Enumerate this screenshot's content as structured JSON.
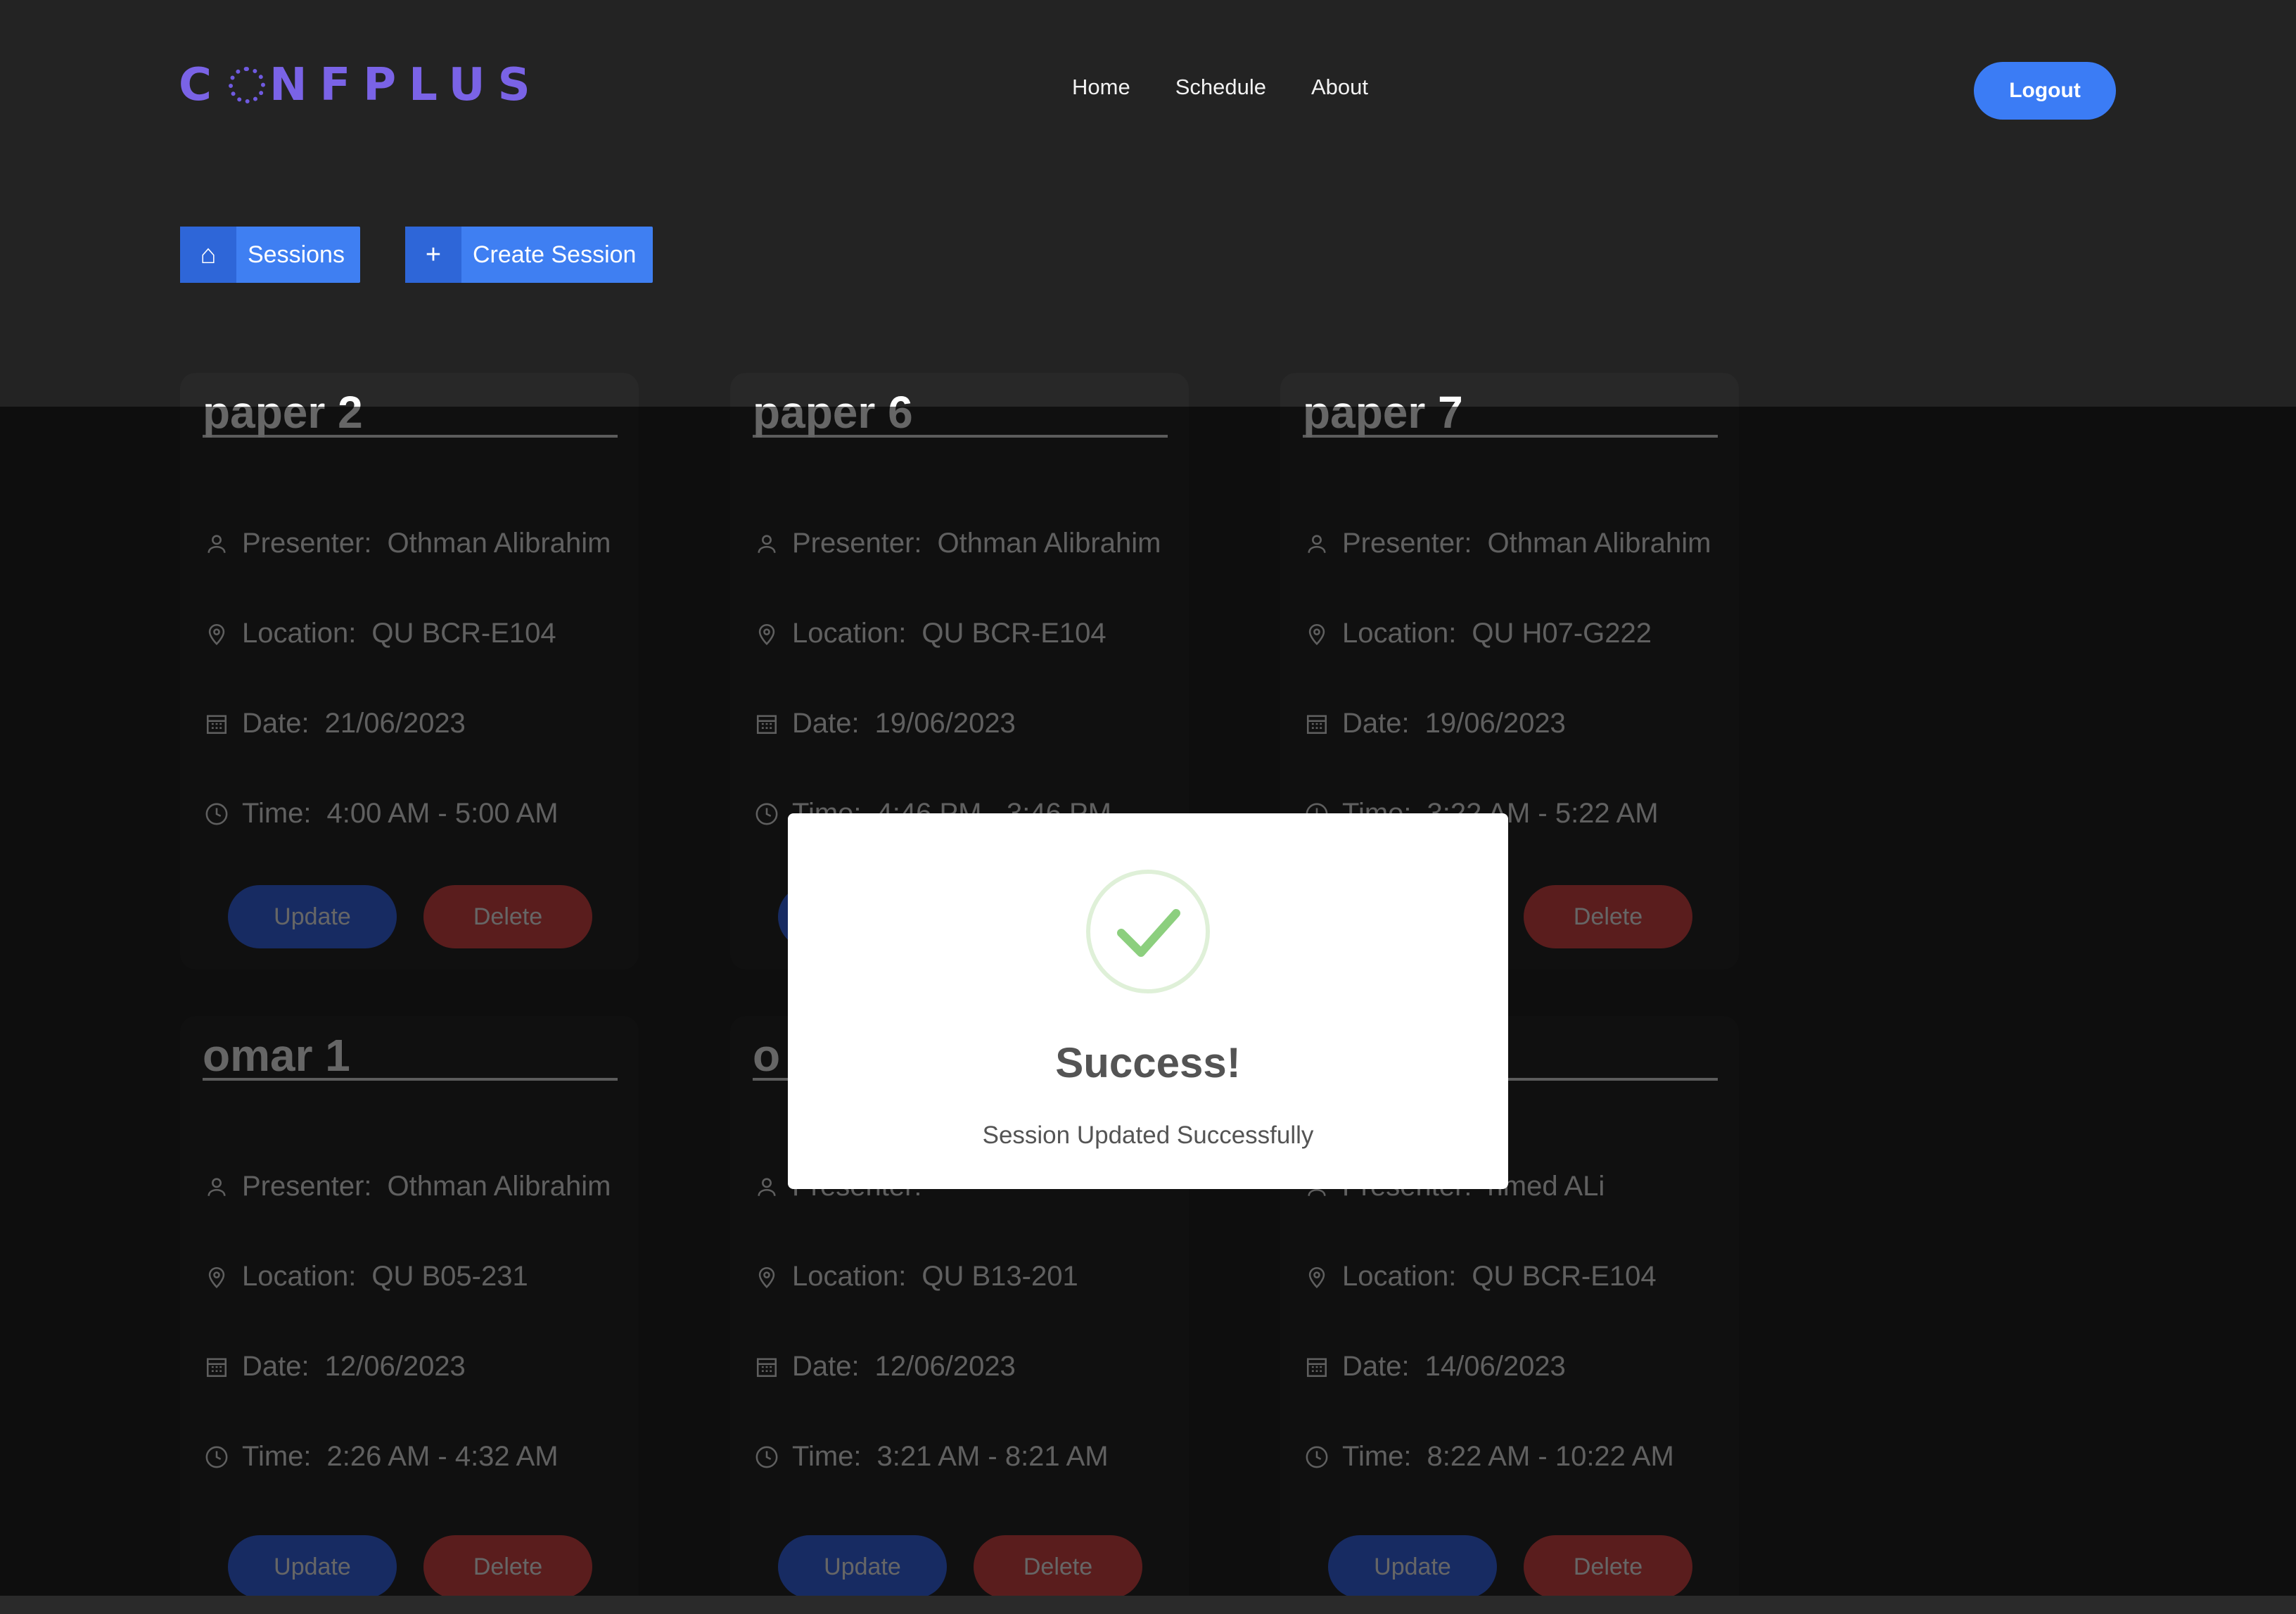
{
  "brand": {
    "logo_text_left": "C",
    "logo_text_right": "NFPLUS"
  },
  "nav": {
    "items": [
      "Home",
      "Schedule",
      "About"
    ],
    "logout_label": "Logout"
  },
  "toolbar": {
    "sessions_label": "Sessions",
    "create_label": "Create Session"
  },
  "labels": {
    "presenter": "Presenter:",
    "location": "Location:",
    "date": "Date:",
    "time": "Time:",
    "update": "Update",
    "delete": "Delete"
  },
  "cards": [
    {
      "title": "paper 2",
      "presenter": "Othman Alibrahim",
      "location": "QU BCR-E104",
      "date": "21/06/2023",
      "time": "4:00 AM - 5:00 AM"
    },
    {
      "title": "paper 6",
      "presenter": "Othman Alibrahim",
      "location": "QU BCR-E104",
      "date": "19/06/2023",
      "time": "4:46 PM - 3:46 PM"
    },
    {
      "title": "paper 7",
      "presenter": "Othman Alibrahim",
      "location": "QU H07-G222",
      "date": "19/06/2023",
      "time": "3:22 AM - 5:22 AM"
    },
    {
      "title": "omar 1",
      "presenter": "Othman Alibrahim",
      "location": "QU B05-231",
      "date": "12/06/2023",
      "time": "2:26 AM - 4:32 AM"
    },
    {
      "title": "o",
      "presenter": "",
      "location": "QU B13-201",
      "date": "12/06/2023",
      "time": "3:21 AM - 8:21 AM"
    },
    {
      "title": "",
      "presenter": "hmed ALi",
      "location": "QU BCR-E104",
      "date": "14/06/2023",
      "time": "8:22 AM - 10:22 AM"
    }
  ],
  "modal": {
    "title": "Success!",
    "message": "Session Updated Successfully"
  }
}
